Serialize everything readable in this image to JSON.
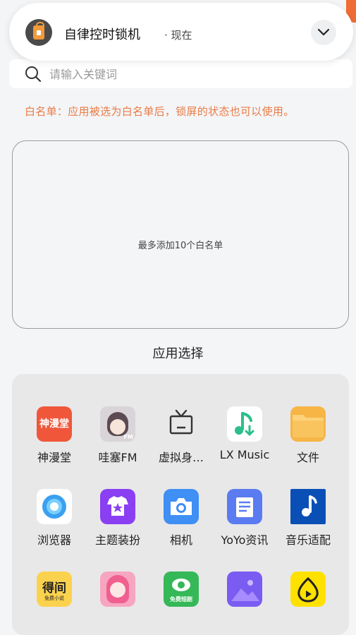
{
  "notification": {
    "app_name": "自律控时锁机",
    "time": "· 现在",
    "icon": "lock-bag-icon"
  },
  "search": {
    "placeholder": "请输入关键词",
    "value": ""
  },
  "hint": "白名单：应用被选为白名单后，锁屏的状态也可以使用。",
  "whitelist": {
    "empty_text": "最多添加10个白名单"
  },
  "section_title": "应用选择",
  "apps": [
    {
      "label": "神漫堂",
      "icon": "shenmantang-icon",
      "color": "#f0573a",
      "icon_text": "神漫堂"
    },
    {
      "label": "哇塞FM",
      "icon": "wasai-fm-icon",
      "color": "#cfcfcf",
      "icon_text": "FM"
    },
    {
      "label": "虚拟身…",
      "icon": "tv-icon",
      "color": "#e8e8e9"
    },
    {
      "label": "LX Music",
      "icon": "music-download-icon",
      "color": "#ffffff"
    },
    {
      "label": "文件",
      "icon": "folder-icon",
      "color": "#f6b545"
    },
    {
      "label": "浏览器",
      "icon": "browser-icon",
      "color": "#ffffff"
    },
    {
      "label": "主题装扮",
      "icon": "theme-shirt-icon",
      "color": "#8a3ff2"
    },
    {
      "label": "相机",
      "icon": "camera-icon",
      "color": "#3f8ff5"
    },
    {
      "label": "YoYo资讯",
      "icon": "news-icon",
      "color": "#5a7cf0"
    },
    {
      "label": "音乐适配",
      "icon": "music-note-icon",
      "color": "#0a4fb5"
    },
    {
      "label": "",
      "icon": "dewen-novel-icon",
      "color": "#fbd24e",
      "icon_text": "得间",
      "icon_subtext": "免费小说"
    },
    {
      "label": "",
      "icon": "anime-girl-icon",
      "color": "#f7a6c0"
    },
    {
      "label": "",
      "icon": "free-drama-icon",
      "color": "#35b857",
      "icon_text": "免费短剧"
    },
    {
      "label": "",
      "icon": "gallery-icon",
      "color": "#7b5cf2"
    },
    {
      "label": "",
      "icon": "video-play-icon",
      "color": "#ffe100"
    }
  ]
}
